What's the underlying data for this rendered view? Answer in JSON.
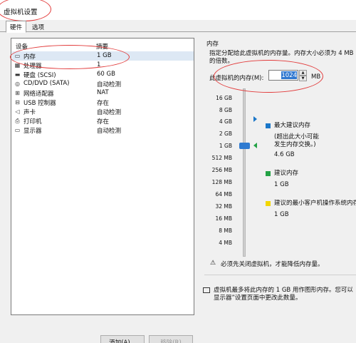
{
  "window": {
    "title": "虚拟机设置"
  },
  "tabs": [
    {
      "label": "硬件",
      "active": true
    },
    {
      "label": "选项",
      "active": false
    }
  ],
  "devices": {
    "header": {
      "device": "设备",
      "summary": "摘要"
    },
    "items": [
      {
        "icon": "memory-icon",
        "name": "内存",
        "summary": "1 GB",
        "selected": true
      },
      {
        "icon": "processor-icon",
        "name": "处理器",
        "summary": "1"
      },
      {
        "icon": "harddisk-icon",
        "name": "硬盘 (SCSI)",
        "summary": "60 GB"
      },
      {
        "icon": "cd-dvd-icon",
        "name": "CD/DVD (SATA)",
        "summary": "自动检测"
      },
      {
        "icon": "network-adapter-icon",
        "name": "网络适配器",
        "summary": "NAT"
      },
      {
        "icon": "usb-icon",
        "name": "USB 控制器",
        "summary": "存在"
      },
      {
        "icon": "sound-card-icon",
        "name": "声卡",
        "summary": "自动检测"
      },
      {
        "icon": "printer-icon",
        "name": "打印机",
        "summary": "存在"
      },
      {
        "icon": "display-icon",
        "name": "显示器",
        "summary": "自动检测"
      }
    ]
  },
  "buttons": {
    "add": "添加(A)...",
    "remove": "移除(R)"
  },
  "memory": {
    "section_title": "内存",
    "description_line1": "指定分配给此虚拟机的内存量。内存大小必须为 4 MB",
    "description_line2": "的倍数。",
    "field_label": "此虚拟机的内存(M):",
    "value": "1024",
    "unit": "MB",
    "scale_labels": [
      "16 GB",
      "8 GB",
      "4 GB",
      "2 GB",
      "1 GB",
      "512 MB",
      "256 MB",
      "128 MB",
      "64 MB",
      "32 MB",
      "16 MB",
      "8 MB",
      "4 MB"
    ],
    "legend": {
      "max_recommended": {
        "color": "#1b77c9",
        "label": "最大建议内存",
        "note_line1": "(超出此大小可能",
        "note_line2": "发生内存交换。)",
        "value": "4.6 GB"
      },
      "recommended": {
        "color": "#23a245",
        "label": "建议内存",
        "value": "1 GB"
      },
      "guest_min": {
        "color": "#f2d600",
        "label": "建议的最小客户机操作系统内存",
        "value": "1 GB"
      }
    },
    "warning": "必须先关闭虚拟机，才能降低内存量。",
    "info_line1": "虚拟机最多将此内存的 1 GB 用作图形内存。您可以",
    "info_line2": "显示器”设置页面中更改此数量。"
  }
}
